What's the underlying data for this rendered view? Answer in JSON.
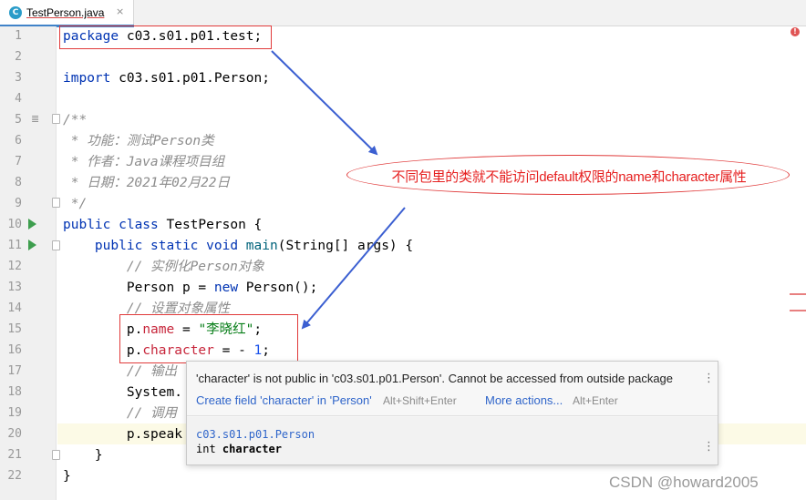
{
  "tab": {
    "title": "TestPerson.java",
    "close": "×",
    "icon": "java-class-icon",
    "icon_letter": "C"
  },
  "gutter": {
    "line_numbers": [
      "1",
      "2",
      "3",
      "4",
      "5",
      "6",
      "7",
      "8",
      "9",
      "10",
      "11",
      "12",
      "13",
      "14",
      "15",
      "16",
      "17",
      "18",
      "19",
      "20",
      "21",
      "22"
    ]
  },
  "code": {
    "l1_kw": "package",
    "l1_rest": " c03.s01.p01.test;",
    "l3_kw": "import",
    "l3_rest": " c03.s01.p01.Person;",
    "l5": "/**",
    "l6": " * 功能：测试Person类",
    "l7": " * 作者：Java课程项目组",
    "l8": " * 日期：2021年02月22日",
    "l9": " */",
    "l10_kw": "public class",
    "l10_rest": " TestPerson {",
    "l11_indent": "    ",
    "l11_kw": "public static void",
    "l11_sp": " ",
    "l11_method": "main",
    "l11_rest": "(String[] args) {",
    "l12": "        // 实例化Person对象",
    "l13_a": "        Person p = ",
    "l13_kw": "new",
    "l13_b": " Person();",
    "l14": "        // 设置对象属性",
    "l15_a": "        p.",
    "l15_field": "name",
    "l15_b": " = ",
    "l15_str": "\"李晓红\"",
    "l15_c": ";",
    "l16_a": "        p.",
    "l16_field": "character",
    "l16_b": " = - ",
    "l16_num": "1",
    "l16_c": ";",
    "l17": "        // 输出",
    "l18": "        System.",
    "l19": "        // 调用",
    "l20": "        p.speak",
    "l21": "    }",
    "l22": "}"
  },
  "annotation": {
    "text": "不同包里的类就不能访问default权限的name和character属性",
    "color": "#e62020"
  },
  "popup": {
    "message": "'character' is not public in 'c03.s01.p01.Person'. Cannot be accessed from outside package",
    "action1": "Create field 'character' in 'Person'",
    "action1_shortcut": "Alt+Shift+Enter",
    "action2": "More actions...",
    "action2_shortcut": "Alt+Enter",
    "class_name": "c03.s01.p01.Person",
    "decl_type": "int",
    "decl_name": "character",
    "menu_icon": "⋮"
  },
  "watermark": "CSDN @howard2005",
  "colors": {
    "keyword": "#0033b3",
    "comment": "#8c8c8c",
    "string": "#067d17",
    "field": "#c7263b",
    "annotation_red": "#e03a3a",
    "arrow_blue": "#3b5fd1"
  }
}
